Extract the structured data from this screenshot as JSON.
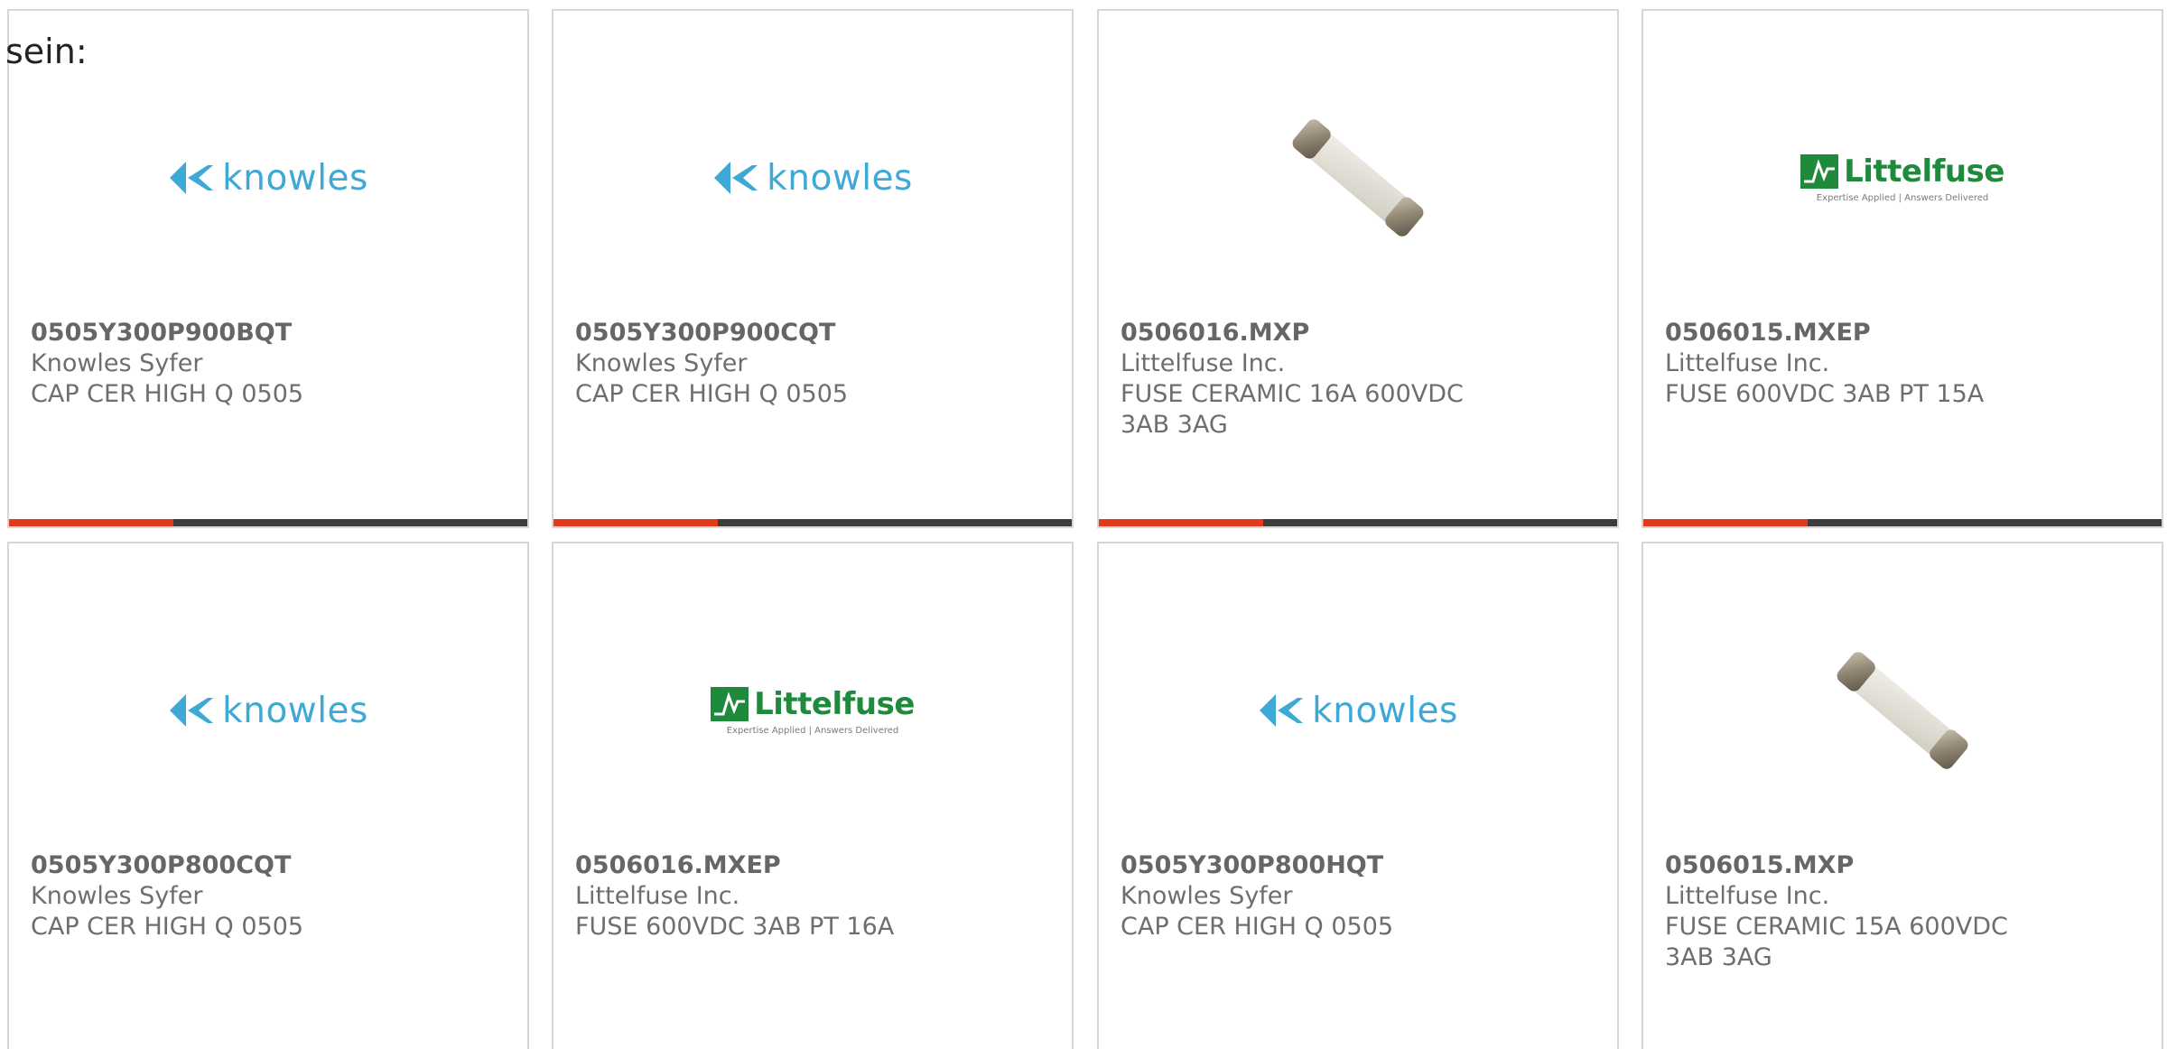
{
  "intro_text": "sein:",
  "products": [
    {
      "part_number": "0505Y300P900BQT",
      "manufacturer": "Knowles Syfer",
      "description": "CAP CER HIGH Q 0505",
      "image": "knowles-logo"
    },
    {
      "part_number": "0505Y300P900CQT",
      "manufacturer": "Knowles Syfer",
      "description": "CAP CER HIGH Q 0505",
      "image": "knowles-logo"
    },
    {
      "part_number": "0506016.MXP",
      "manufacturer": "Littelfuse Inc.",
      "description": "FUSE CERAMIC 16A 600VDC 3AB 3AG",
      "image": "ceramic-fuse-photo"
    },
    {
      "part_number": "0506015.MXEP",
      "manufacturer": "Littelfuse Inc.",
      "description": "FUSE 600VDC 3AB PT 15A",
      "image": "littelfuse-logo"
    },
    {
      "part_number": "0505Y300P800CQT",
      "manufacturer": "Knowles Syfer",
      "description": "CAP CER HIGH Q 0505",
      "image": "knowles-logo"
    },
    {
      "part_number": "0506016.MXEP",
      "manufacturer": "Littelfuse Inc.",
      "description": "FUSE 600VDC 3AB PT 16A",
      "image": "littelfuse-logo"
    },
    {
      "part_number": "0505Y300P800HQT",
      "manufacturer": "Knowles Syfer",
      "description": "CAP CER HIGH Q 0505",
      "image": "knowles-logo"
    },
    {
      "part_number": "0506015.MXP",
      "manufacturer": "Littelfuse Inc.",
      "description": "FUSE CERAMIC 15A 600VDC 3AB 3AG",
      "image": "ceramic-fuse-photo"
    }
  ],
  "logos": {
    "knowles": "knowles",
    "littelfuse": "Littelfuse",
    "littelfuse_tagline": "Expertise Applied | Answers Delivered"
  },
  "colors": {
    "accent": "#e03c1c",
    "bar": "#3c3c3c",
    "knowles_blue": "#3ea8d6",
    "littelfuse_green": "#1f8a3c",
    "text": "#6e6e6e"
  }
}
